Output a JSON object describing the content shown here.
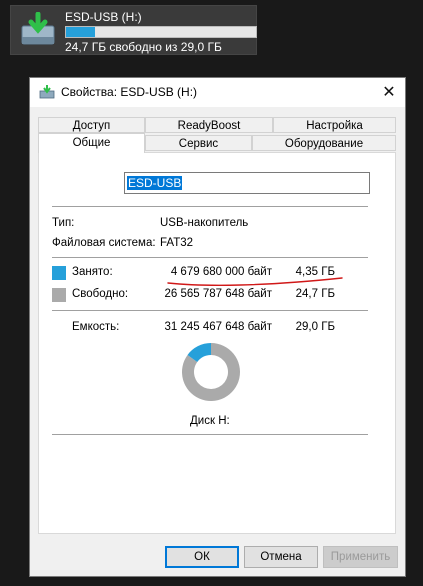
{
  "explorer_tile": {
    "name": "ESD-USB (H:)",
    "free_text": "24,7 ГБ свободно из 29,0 ГБ",
    "used_fraction": 0.15,
    "icon": "usb-drive-icon"
  },
  "dialog": {
    "title": "Свойства: ESD-USB (H:)",
    "close_glyph": "✕",
    "tabs_back": [
      "Доступ",
      "ReadyBoost",
      "Настройка"
    ],
    "tabs_front": [
      "Общие",
      "Сервис",
      "Оборудование"
    ],
    "active_tab": "Общие",
    "volume_name": "ESD-USB",
    "type_label": "Тип:",
    "type_value": "USB-накопитель",
    "fs_label": "Файловая система:",
    "fs_value": "FAT32",
    "used_label": "Занято:",
    "used_bytes": "4 679 680 000 байт",
    "used_size": "4,35 ГБ",
    "free_label": "Свободно:",
    "free_bytes": "26 565 787 648 байт",
    "free_size": "24,7 ГБ",
    "capacity_label": "Емкость:",
    "capacity_bytes": "31 245 467 648 байт",
    "capacity_size": "29,0 ГБ",
    "disk_label": "Диск H:",
    "used_fraction": 0.15,
    "colors": {
      "used": "#26a0da",
      "free": "#aaaaaa"
    },
    "buttons": {
      "ok": "ОК",
      "cancel": "Отмена",
      "apply": "Применить"
    }
  }
}
